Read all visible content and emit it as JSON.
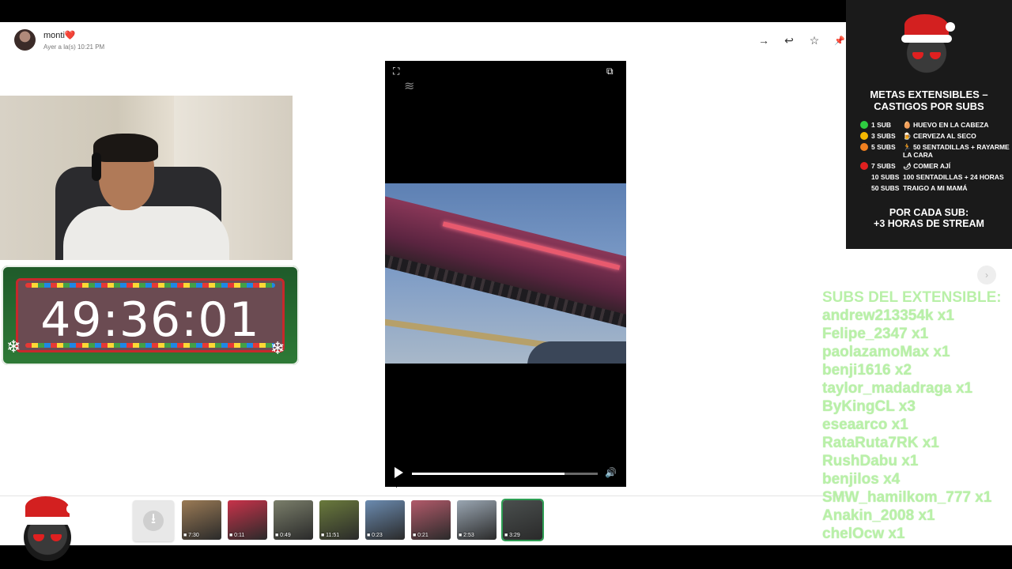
{
  "message": {
    "sender_name": "monti❤️",
    "timestamp": "Ayer a la(s) 10:21 PM"
  },
  "toolbar": {
    "forward_icon": "→",
    "reply_icon": "↩",
    "star_icon": "☆",
    "pin_icon": "📌"
  },
  "timer": {
    "value": "49:36:01"
  },
  "player": {
    "expand_icon": "⛶",
    "popout_icon": "⧉",
    "logo_icon": "≋",
    "volume_icon": "🔊",
    "progress": 0.82
  },
  "thumbnails": [
    {
      "duration": "7:30",
      "color": "#9a7a55"
    },
    {
      "duration": "0:11",
      "color": "#c8324a"
    },
    {
      "duration": "0:49",
      "color": "#7a7e6a"
    },
    {
      "duration": "11:51",
      "color": "#6a7a3c"
    },
    {
      "duration": "0:23",
      "color": "#6b8bb0"
    },
    {
      "duration": "0:21",
      "color": "#b25a6a"
    },
    {
      "duration": "2:53",
      "color": "#9aa6b2"
    },
    {
      "duration": "3:29",
      "color": "#4a4f4e"
    }
  ],
  "download_icon": "⭳",
  "panel": {
    "title_line1": "METAS EXTENSIBLES –",
    "title_line2": "CASTIGOS POR SUBS",
    "goals": [
      {
        "subs": "1 SUB",
        "desc": "🥚 HUEVO EN LA CABEZA",
        "color": "#2ecc40"
      },
      {
        "subs": "3 SUBS",
        "desc": "🍺 CERVEZA AL SECO",
        "color": "#f5b800"
      },
      {
        "subs": "5 SUBS",
        "desc": "🏃 50 SENTADILLAS + RAYARME LA CARA",
        "color": "#f08020"
      },
      {
        "subs": "7 SUBS",
        "desc": "🌶 COMER AJÍ",
        "color": "#e02020"
      },
      {
        "subs": "10 SUBS",
        "desc": "100 SENTADILLAS + 24 HORAS",
        "color": "#1a1a1a"
      },
      {
        "subs": "50 SUBS",
        "desc": "TRAIGO A MI MAMÁ",
        "color": "#1a1a1a"
      }
    ],
    "footer_line1": "POR CADA SUB:",
    "footer_line2": "+3 HORAS DE STREAM"
  },
  "subs_list": {
    "title": "SUBS DEL EXTENSIBLE:",
    "entries": [
      "andrew213354k x1",
      "Felipe_2347 x1",
      "paolazamoMax x1",
      "benji1616 x2",
      "taylor_madadraga x1",
      "ByKingCL x3",
      "eseaarco x1",
      "RataRuta7RK x1",
      "RushDabu x1",
      "benjilos x4",
      "SMW_hamilkom_777 x1",
      "Anakin_2008 x1",
      "chelOcw x1"
    ]
  },
  "next_icon": "›"
}
